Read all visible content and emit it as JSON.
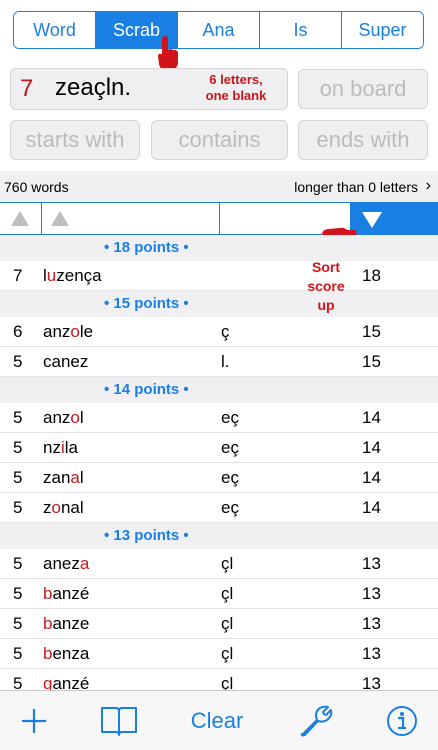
{
  "tabs": [
    {
      "label": "Word",
      "active": false
    },
    {
      "label": "Scrab",
      "active": true
    },
    {
      "label": "Ana",
      "active": false
    },
    {
      "label": "Is",
      "active": false
    },
    {
      "label": "Super",
      "active": false
    }
  ],
  "rack": {
    "count": "7",
    "letters": "zeaçln.",
    "hint_line1": "6 letters,",
    "hint_line2": "one blank"
  },
  "fields": {
    "on_board": "on board",
    "starts_with": "starts with",
    "contains": "contains",
    "ends_with": "ends with"
  },
  "status": {
    "word_count": "760 words",
    "filter": "longer than 0 letters",
    "chevron": "›"
  },
  "sort_note": {
    "line1": "Sort",
    "line2": "score",
    "line3": "up"
  },
  "groups": [
    {
      "title": "• 18 points •",
      "rows": [
        {
          "len": "7",
          "pre": "l",
          "hl": "u",
          "post": "zença",
          "blank": "",
          "score": "18"
        }
      ]
    },
    {
      "title": "• 15 points •",
      "rows": [
        {
          "len": "6",
          "pre": "anz",
          "hl": "o",
          "post": "le",
          "blank": "ç",
          "score": "15"
        },
        {
          "len": "5",
          "pre": "canez",
          "hl": "",
          "post": "",
          "blank": "l.",
          "score": "15"
        }
      ]
    },
    {
      "title": "• 14 points •",
      "rows": [
        {
          "len": "5",
          "pre": "anz",
          "hl": "o",
          "post": "l",
          "blank": "eç",
          "score": "14"
        },
        {
          "len": "5",
          "pre": "nz",
          "hl": "i",
          "post": "la",
          "blank": "eç",
          "score": "14"
        },
        {
          "len": "5",
          "pre": "zan",
          "hl": "a",
          "post": "l",
          "blank": "eç",
          "score": "14"
        },
        {
          "len": "5",
          "pre": "z",
          "hl": "o",
          "post": "nal",
          "blank": "eç",
          "score": "14"
        }
      ]
    },
    {
      "title": "• 13 points •",
      "rows": [
        {
          "len": "5",
          "pre": "anez",
          "hl": "a",
          "post": "",
          "blank": "çl",
          "score": "13"
        },
        {
          "len": "5",
          "pre": "",
          "hl": "b",
          "post": "anzé",
          "blank": "çl",
          "score": "13"
        },
        {
          "len": "5",
          "pre": "",
          "hl": "b",
          "post": "anze",
          "blank": "çl",
          "score": "13"
        },
        {
          "len": "5",
          "pre": "",
          "hl": "b",
          "post": "enza",
          "blank": "çl",
          "score": "13"
        },
        {
          "len": "5",
          "pre": "",
          "hl": "g",
          "post": "anzé",
          "blank": "çl",
          "score": "13"
        }
      ]
    }
  ],
  "toolbar": {
    "add_icon": "plus-icon",
    "book_icon": "book-icon",
    "clear_label": "Clear",
    "wrench_icon": "wrench-icon",
    "info_icon": "info-icon"
  },
  "colors": {
    "accent": "#1a7fe3",
    "highlight": "#c7191e",
    "annotation": "#d0141a"
  }
}
